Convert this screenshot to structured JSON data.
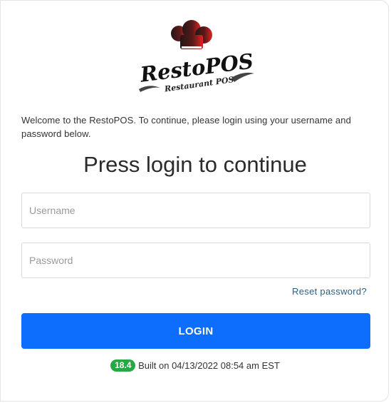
{
  "logo": {
    "brand": "RestoPOS",
    "tagline": "Restaurant POS",
    "icon": "chef-hat-icon"
  },
  "welcome_text": "Welcome to the RestoPOS. To continue, please login using your username and password below.",
  "heading": "Press login to continue",
  "username": {
    "value": "",
    "placeholder": "Username"
  },
  "password": {
    "value": "",
    "placeholder": "Password"
  },
  "reset_link": "Reset password?",
  "login_button": "LOGIN",
  "build": {
    "version": "18.4",
    "text": "Built on 04/13/2022 08:54 am EST"
  },
  "colors": {
    "primary": "#0d6efd",
    "badge": "#28a745",
    "link": "#2a5f86",
    "hat_dark": "#2a1a1a",
    "hat_red": "#e02020"
  }
}
